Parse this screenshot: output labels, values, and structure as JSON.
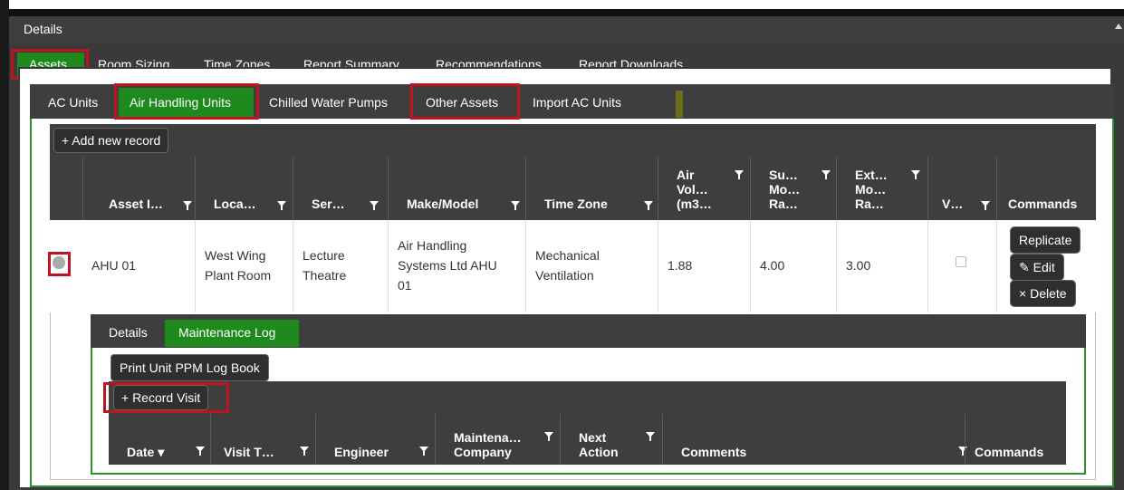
{
  "details_bar": {
    "label": "Details"
  },
  "main_tabs": [
    {
      "label": "Assets",
      "active": true
    },
    {
      "label": "Room Sizing"
    },
    {
      "label": "Time Zones"
    },
    {
      "label": "Report Summary"
    },
    {
      "label": "Recommendations"
    },
    {
      "label": "Report Downloads"
    }
  ],
  "asset_tabs": [
    {
      "label": "AC Units"
    },
    {
      "label": "Air Handling Units",
      "active": true
    },
    {
      "label": "Chilled Water Pumps"
    },
    {
      "label": "Other Assets"
    },
    {
      "label": "Import AC Units"
    }
  ],
  "grid": {
    "add_button": "+ Add new record",
    "columns": [
      {
        "label": "Asset I…"
      },
      {
        "label": "Loca…"
      },
      {
        "label": "Ser…"
      },
      {
        "label": "Make/Model"
      },
      {
        "label": "Time Zone"
      },
      {
        "label": "Air\nVol…\n(m3…"
      },
      {
        "label": "Su…\nMo…\nRa…"
      },
      {
        "label": "Ext…\nMo…\nRa…"
      },
      {
        "label": "V…"
      },
      {
        "label": "Commands"
      }
    ],
    "row": {
      "asset_id": "AHU 01",
      "location_1": "West Wing",
      "location_2": "Plant Room",
      "service_1": "Lecture",
      "service_2": "Theatre",
      "make_1": "Air Handling",
      "make_2": "Systems Ltd AHU",
      "make_3": "01",
      "timezone_1": "Mechanical",
      "timezone_2": "Ventilation",
      "air_volume": "1.88",
      "supply_motor": "4.00",
      "extract_motor": "3.00",
      "replicate": "Replicate",
      "edit": "Edit",
      "delete": "Delete"
    }
  },
  "detail_tabs": [
    {
      "label": "Details"
    },
    {
      "label": "Maintenance Log",
      "active": true
    }
  ],
  "maintenance": {
    "print_button": "Print Unit PPM Log Book",
    "record_button": "+ Record Visit",
    "columns": [
      {
        "label": "Date ▾"
      },
      {
        "label": "Visit T…"
      },
      {
        "label": "Engineer"
      },
      {
        "label": "Maintena…\nCompany"
      },
      {
        "label": "Next\nAction"
      },
      {
        "label": "Comments"
      },
      {
        "label": "Commands"
      }
    ]
  },
  "colors": {
    "active_tab": "#1e8a1e",
    "highlight": "#c1121f",
    "bar": "#3e3e3e"
  }
}
